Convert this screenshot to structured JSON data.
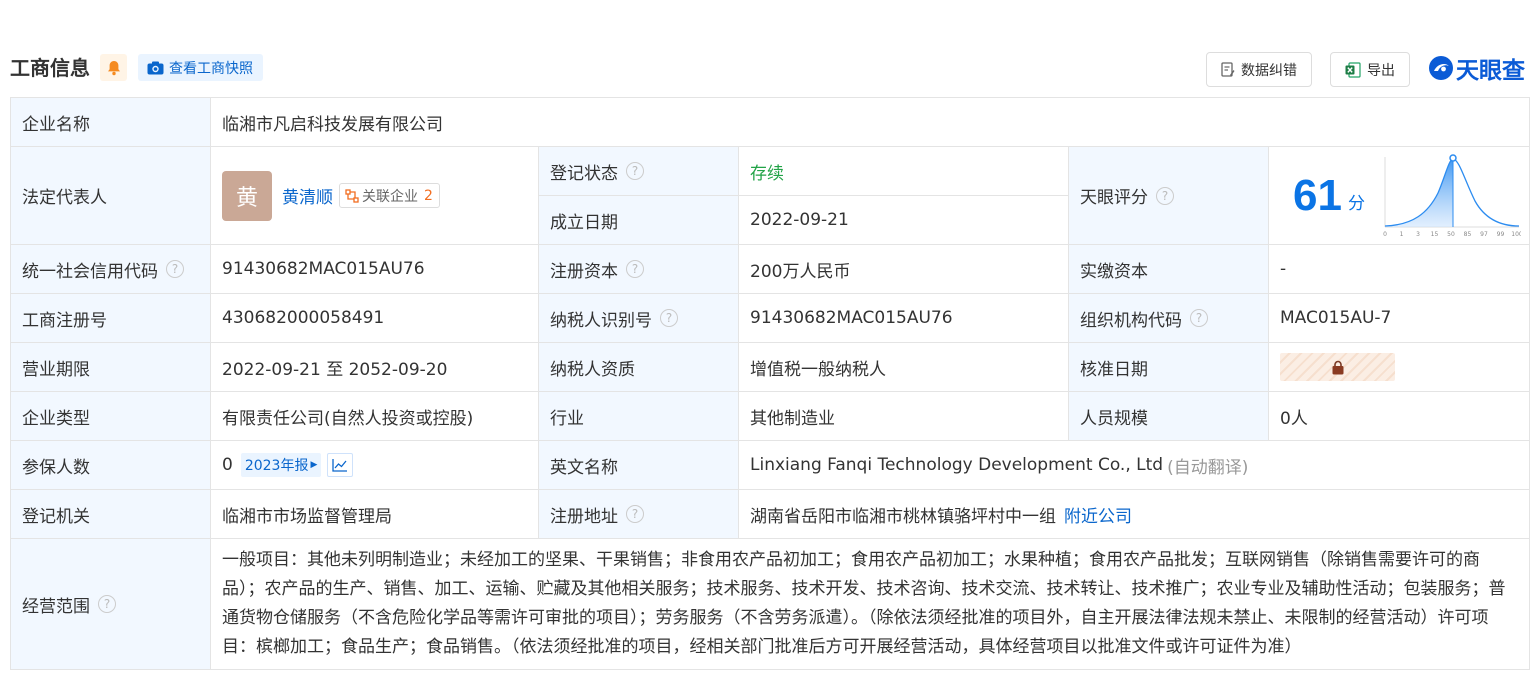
{
  "header": {
    "title": "工商信息",
    "snapshot_button": "查看工商快照",
    "correct_button": "数据纠错",
    "export_button": "导出",
    "brand": "天眼查"
  },
  "rows": {
    "company_name": {
      "label": "企业名称",
      "value": "临湘市凡启科技发展有限公司"
    },
    "legal_rep": {
      "label": "法定代表人",
      "avatar_char": "黄",
      "name": "黄清顺",
      "related_label": "关联企业",
      "related_count": "2"
    },
    "reg_status": {
      "label": "登记状态",
      "value": "存续"
    },
    "est_date": {
      "label": "成立日期",
      "value": "2022-09-21"
    },
    "tianyan_score": {
      "label": "天眼评分",
      "score": "61",
      "unit": "分",
      "axis_ticks": [
        "0",
        "1",
        "3",
        "15",
        "50",
        "85",
        "97",
        "99",
        "100"
      ]
    },
    "credit_code": {
      "label": "统一社会信用代码",
      "value": "91430682MAC015AU76"
    },
    "reg_capital": {
      "label": "注册资本",
      "value": "200万人民币"
    },
    "paid_capital": {
      "label": "实缴资本",
      "value": "-"
    },
    "biz_reg_no": {
      "label": "工商注册号",
      "value": "430682000058491"
    },
    "taxpayer_id": {
      "label": "纳税人识别号",
      "value": "91430682MAC015AU76"
    },
    "org_code": {
      "label": "组织机构代码",
      "value": "MAC015AU-7"
    },
    "biz_term": {
      "label": "营业期限",
      "value": "2022-09-21 至 2052-09-20"
    },
    "taxpayer_qual": {
      "label": "纳税人资质",
      "value": "增值税一般纳税人"
    },
    "approval_date": {
      "label": "核准日期"
    },
    "company_type": {
      "label": "企业类型",
      "value": "有限责任公司(自然人投资或控股)"
    },
    "industry": {
      "label": "行业",
      "value": "其他制造业"
    },
    "staff_size": {
      "label": "人员规模",
      "value": "0人"
    },
    "insured": {
      "label": "参保人数",
      "value": "0",
      "report": "2023年报"
    },
    "english_name": {
      "label": "英文名称",
      "value": "Linxiang Fanqi Technology Development Co., Ltd",
      "note": "(自动翻译)"
    },
    "reg_authority": {
      "label": "登记机关",
      "value": "临湘市市场监督管理局"
    },
    "reg_address": {
      "label": "注册地址",
      "value": "湖南省岳阳市临湘市桃林镇骆坪村中一组",
      "nearby": "附近公司"
    },
    "biz_scope": {
      "label": "经营范围",
      "value": "一般项目：其他未列明制造业；未经加工的坚果、干果销售；非食用农产品初加工；食用农产品初加工；水果种植；食用农产品批发；互联网销售（除销售需要许可的商品）；农产品的生产、销售、加工、运输、贮藏及其他相关服务；技术服务、技术开发、技术咨询、技术交流、技术转让、技术推广；农业专业及辅助性活动；包装服务；普通货物仓储服务（不含危险化学品等需许可审批的项目）；劳务服务（不含劳务派遣）。（除依法须经批准的项目外，自主开展法律法规未禁止、未限制的经营活动）许可项目：槟榔加工；食品生产；食品销售。（依法须经批准的项目，经相关部门批准后方可开展经营活动，具体经营项目以批准文件或许可证件为准）"
    }
  },
  "colors": {
    "label_bg": "#f2f8ff",
    "link": "#0a66cc",
    "status_green": "#22a347",
    "score_blue": "#0b74e5",
    "badge_orange": "#f26d20"
  }
}
